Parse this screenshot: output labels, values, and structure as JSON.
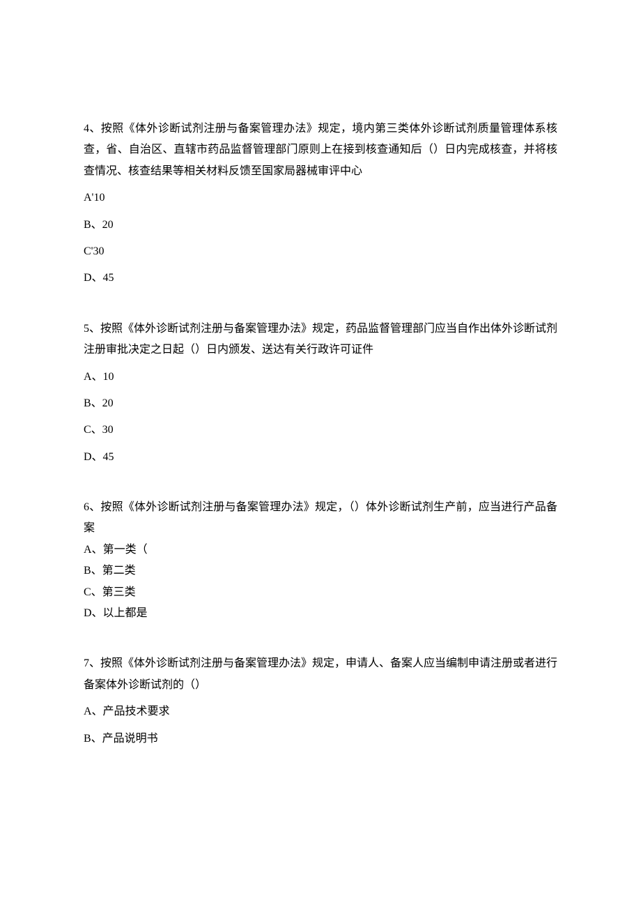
{
  "questions": [
    {
      "stem": "4、按照《体外诊断试剂注册与备案管理办法》规定，境内第三类体外诊断试剂质量管理体系核查，省、自治区、直辖市药品监督管理部门原则上在接到核查通知后（）日内完成核查，并将核查情况、核查结果等相关材料反馈至国家局器械审评中心",
      "options": [
        {
          "text": "A'10"
        },
        {
          "text": "B、20"
        },
        {
          "text": "C'30"
        },
        {
          "text": "D、45"
        }
      ]
    },
    {
      "stem": "5、按照《体外诊断试剂注册与备案管理办法》规定，药品监督管理部门应当自作出体外诊断试剂注册审批决定之日起（）日内颁发、送达有关行政许可证件",
      "options": [
        {
          "text": "A、10"
        },
        {
          "text": "B、20"
        },
        {
          "text": "C、30"
        },
        {
          "text": "D、45"
        }
      ]
    },
    {
      "stem": "6、按照《体外诊断试剂注册与备案管理办法》规定，（）体外诊断试剂生产前，应当进行产品备案",
      "tight": true,
      "options": [
        {
          "a_prefix": "A、",
          "a_body": "第一类（",
          "kai": true
        },
        {
          "text": "B、第二类"
        },
        {
          "text": "C、第三类"
        },
        {
          "text": "D、以上都是"
        }
      ]
    },
    {
      "stem": "7、按照《体外诊断试剂注册与备案管理办法》规定，申请人、备案人应当编制申请注册或者进行备案体外诊断试剂的（）",
      "options": [
        {
          "text": "A、产品技术要求"
        },
        {
          "text": "B、产品说明书"
        }
      ]
    }
  ]
}
